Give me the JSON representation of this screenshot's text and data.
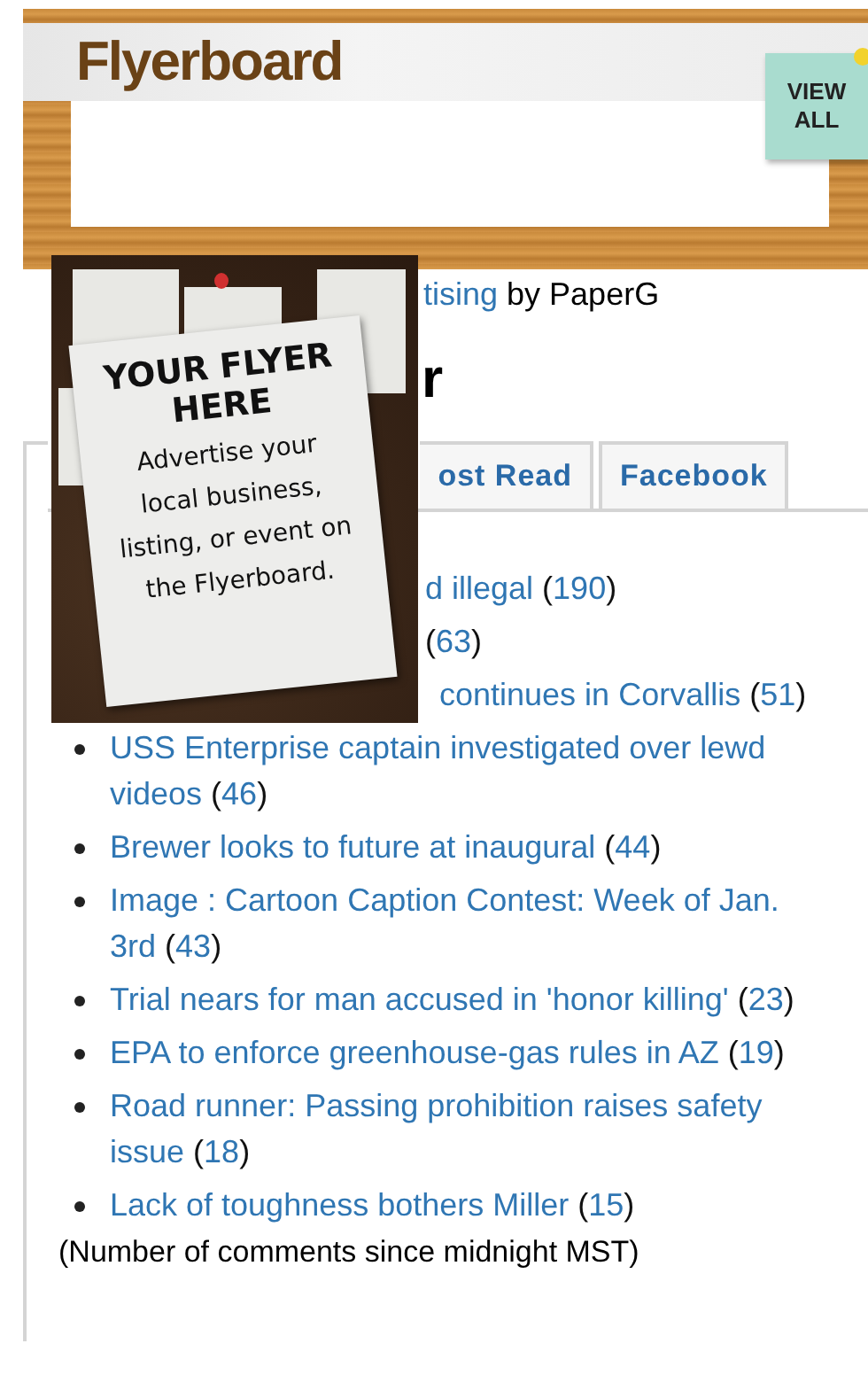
{
  "flyerboard": {
    "logo": "Flyerboard",
    "view_all": [
      "VIEW",
      "ALL"
    ]
  },
  "flyer_ad": {
    "headline": [
      "YOUR FLYER",
      "HERE"
    ],
    "body": [
      "Advertise your",
      "local business,",
      "listing, or event on",
      "the Flyerboard."
    ]
  },
  "byline": {
    "link": "tising",
    "text": "by PaperG"
  },
  "heading": "r",
  "tabs": [
    {
      "selected": true
    },
    {
      "label": "ost Read",
      "selected": false
    },
    {
      "label": "Facebook",
      "selected": false
    }
  ],
  "items": [
    {
      "kind": "covered",
      "title": "d illegal",
      "brackets": [
        "(",
        ")"
      ],
      "count": "190"
    },
    {
      "kind": "covered",
      "brackets": [
        "(",
        ")"
      ],
      "count": "63"
    },
    {
      "kind": "covered",
      "title": "continues in Corvallis",
      "brackets": [
        "(",
        ")"
      ],
      "count": "51"
    },
    {
      "kind": "full",
      "title": "USS Enterprise captain investigated over lewd videos",
      "brackets": [
        "(",
        ")"
      ],
      "count": "46"
    },
    {
      "kind": "full",
      "title": "Brewer looks to future at inaugural",
      "brackets": [
        "(",
        ")"
      ],
      "count": "44"
    },
    {
      "kind": "full",
      "title": "Image : Cartoon Caption Contest: Week of Jan. 3rd",
      "brackets": [
        "(",
        ")"
      ],
      "count": "43"
    },
    {
      "kind": "full",
      "title": "Trial nears for man accused in 'honor killing'",
      "brackets": [
        "(",
        ")"
      ],
      "count": "23"
    },
    {
      "kind": "full",
      "title": "EPA to enforce greenhouse-gas rules in AZ",
      "brackets": [
        "(",
        ")"
      ],
      "count": "19"
    },
    {
      "kind": "full",
      "title": "Road runner: Passing prohibition raises safety issue",
      "brackets": [
        "(",
        ")"
      ],
      "count": "18"
    },
    {
      "kind": "full",
      "title": "Lack of toughness bothers Miller",
      "brackets": [
        "(",
        ")"
      ],
      "count": "15"
    }
  ],
  "note": "(Number of comments since midnight MST)"
}
